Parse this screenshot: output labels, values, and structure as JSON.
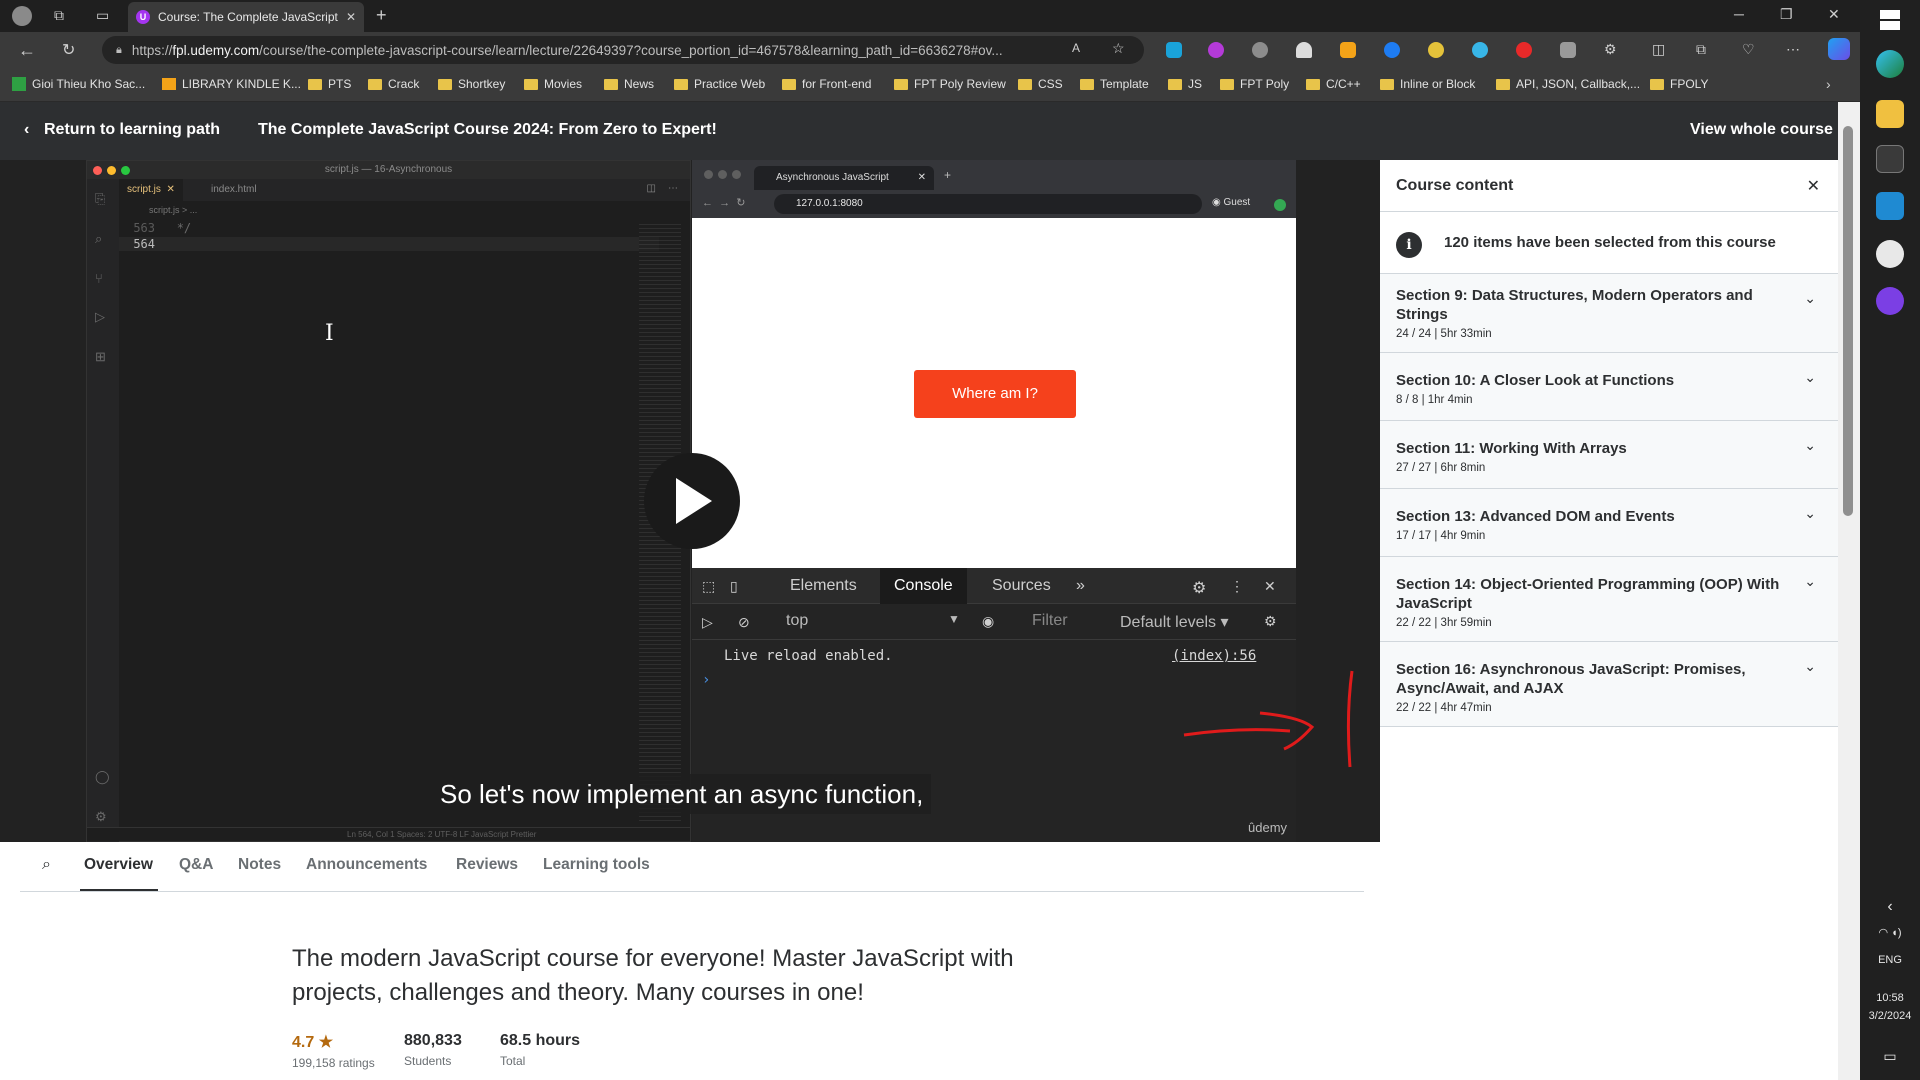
{
  "browser": {
    "tab_title": "Course: The Complete JavaScript",
    "url_prefix": "https://",
    "url_host": "fpl.udemy.com",
    "url_path": "/course/the-complete-javascript-course/learn/lecture/22649397?course_portion_id=467578&learning_path_id=6636278#ov..."
  },
  "bookmarks": [
    "Gioi Thieu Kho Sac...",
    "LIBRARY KINDLE K...",
    "PTS",
    "Crack",
    "Shortkey",
    "Movies",
    "News",
    "Practice Web",
    "for Front-end",
    "FPT Poly Review",
    "CSS",
    "Template",
    "JS",
    "FPT Poly",
    "C/C++",
    "Inline or Block",
    "API, JSON, Callback,...",
    "FPOLY"
  ],
  "header": {
    "back_label": "Return to learning path",
    "course_title": "The Complete JavaScript Course 2024: From Zero to Expert!",
    "view_whole": "View whole course"
  },
  "video": {
    "vscode_title": "script.js — 16-Asynchronous",
    "tab_script": "script.js",
    "tab_index": "index.html",
    "breadcrumb": "script.js > ...",
    "line1_no": "563",
    "line1_code": "*/",
    "line2_no": "564",
    "status_text": "Ln 564, Col 1   Spaces: 2   UTF-8   LF   JavaScript   Prettier",
    "chrome_tab": "Asynchronous JavaScript",
    "chrome_url": "127.0.0.1:8080",
    "chrome_user": "Guest",
    "button_label": "Where am I?",
    "dt_elements": "Elements",
    "dt_console": "Console",
    "dt_sources": "Sources",
    "dt_more": "»",
    "dt_context": "top",
    "dt_filter": "Filter",
    "dt_levels": "Default levels ▾",
    "console_msg": "Live reload enabled.",
    "console_src": "(index):56",
    "caption": "So let's now implement an async function,",
    "watermark": "ûdemy"
  },
  "sidebar": {
    "title": "Course content",
    "info": "120 items have been selected from this course",
    "sections": [
      {
        "title": "Section 9: Data Structures, Modern Operators and Strings",
        "meta": "24 / 24 | 5hr 33min"
      },
      {
        "title": "Section 10: A Closer Look at Functions",
        "meta": "8 / 8 | 1hr 4min"
      },
      {
        "title": "Section 11: Working With Arrays",
        "meta": "27 / 27 | 6hr 8min"
      },
      {
        "title": "Section 13: Advanced DOM and Events",
        "meta": "17 / 17 | 4hr 9min"
      },
      {
        "title": "Section 14: Object-Oriented Programming (OOP) With JavaScript",
        "meta": "22 / 22 | 3hr 59min"
      },
      {
        "title": "Section 16: Asynchronous JavaScript: Promises, Async/Await, and AJAX",
        "meta": "22 / 22 | 4hr 47min"
      }
    ]
  },
  "lower": {
    "tabs": [
      "Overview",
      "Q&A",
      "Notes",
      "Announcements",
      "Reviews",
      "Learning tools"
    ],
    "description": "The modern JavaScript course for everyone! Master JavaScript with projects, challenges and theory. Many courses in one!",
    "rating": "4.7",
    "ratings_count": "199,158 ratings",
    "students": "880,833",
    "students_label": "Students",
    "hours": "68.5 hours",
    "hours_label": "Total"
  },
  "tray": {
    "lang": "ENG",
    "time": "10:58",
    "date": "3/2/2024"
  },
  "colors": {
    "accent": "#a435f0",
    "button": "#f5411c",
    "annotation": "#e01b1b"
  }
}
